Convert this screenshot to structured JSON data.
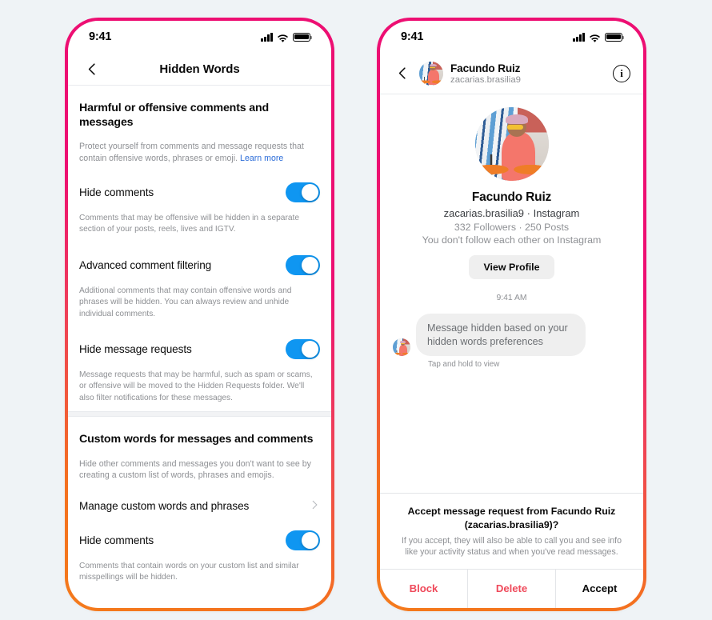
{
  "theme": {
    "page_background": "#eff3f6",
    "frame_gradient_start": "#ED0E72",
    "frame_gradient_end": "#F47A1C",
    "toggle_on_color": "#0f96f1",
    "link_color": "#2b6cd8",
    "danger_color": "#ef4a5b"
  },
  "left_phone": {
    "status_bar": {
      "time": "9:41",
      "signal_icon": "cellular-signal-icon",
      "wifi_icon": "wifi-icon",
      "battery_icon": "battery-full-icon"
    },
    "nav": {
      "back_icon": "chevron-left-icon",
      "title": "Hidden Words"
    },
    "section_one": {
      "title": "Harmful or offensive comments and messages",
      "description": "Protect yourself from comments and message requests that contain offensive words, phrases or emoji.",
      "link_label": "Learn more",
      "rows": [
        {
          "label": "Hide comments",
          "toggle_state": "on",
          "help": "Comments that may be offensive will be hidden in a separate section of your posts, reels, lives and IGTV."
        },
        {
          "label": "Advanced comment filtering",
          "toggle_state": "on",
          "help": "Additional comments that may contain offensive words and phrases will be hidden. You can always review and unhide individual comments."
        },
        {
          "label": "Hide message requests",
          "toggle_state": "on",
          "help": "Message requests that may be harmful, such as spam or scams, or offensive will be moved to the Hidden Requests folder. We'll also filter notifications for these messages."
        }
      ]
    },
    "section_two": {
      "title": "Custom words for messages and comments",
      "description": "Hide other comments and messages you don't want to see by creating a custom list of words, phrases and emojis.",
      "manage_row": {
        "label": "Manage custom words and phrases",
        "chevron_icon": "chevron-right-icon"
      },
      "toggle_row": {
        "label": "Hide comments",
        "toggle_state": "on",
        "help": "Comments that contain words on your custom list and similar misspellings will be hidden."
      }
    }
  },
  "right_phone": {
    "status_bar": {
      "time": "9:41",
      "signal_icon": "cellular-signal-icon",
      "wifi_icon": "wifi-icon",
      "battery_icon": "battery-full-icon"
    },
    "header": {
      "back_icon": "chevron-left-icon",
      "avatar_icon": "user-avatar-photo",
      "name": "Facundo Ruiz",
      "handle": "zacarias.brasilia9",
      "info_icon": "info-circle-icon"
    },
    "profile_card": {
      "avatar_icon": "user-avatar-photo-large",
      "name": "Facundo Ruiz",
      "subtitle": "zacarias.brasilia9 · Instagram",
      "stats": "332 Followers · 250 Posts",
      "relationship": "You don't follow each other on Instagram",
      "view_profile_label": "View Profile"
    },
    "thread": {
      "timestamp": "9:41 AM",
      "message": {
        "avatar_icon": "sender-avatar-photo",
        "text": "Message hidden based on your hidden words preferences",
        "meta": "Tap and hold to view"
      }
    },
    "action_sheet": {
      "title": "Accept message request from Facundo Ruiz (zacarias.brasilia9)?",
      "description": "If you accept, they will also be able to call you and see info like your activity status and when you've read messages.",
      "buttons": [
        {
          "label": "Block",
          "style": "danger"
        },
        {
          "label": "Delete",
          "style": "danger"
        },
        {
          "label": "Accept",
          "style": "neutral"
        }
      ]
    }
  }
}
